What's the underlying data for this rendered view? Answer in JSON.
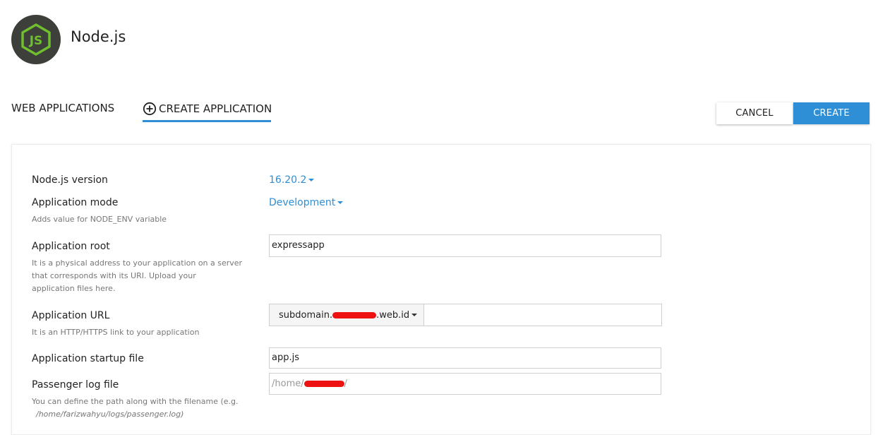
{
  "header": {
    "title": "Node.js",
    "logo_icon": "nodejs-hexagon-icon"
  },
  "tabs": [
    {
      "label": "WEB APPLICATIONS",
      "active": false
    },
    {
      "label": "CREATE APPLICATION",
      "active": true,
      "icon": "plus-circle-icon"
    }
  ],
  "actions": {
    "cancel_label": "CANCEL",
    "create_label": "CREATE"
  },
  "form": {
    "version": {
      "label": "Node.js version",
      "value": "16.20.2"
    },
    "mode": {
      "label": "Application mode",
      "value": "Development",
      "hint": "Adds value for NODE_ENV variable"
    },
    "root": {
      "label": "Application root",
      "value": "expressapp",
      "hint_line1": "It is a physical address to your application on a server",
      "hint_line2": "that corresponds with its URI. Upload your",
      "hint_line3": "application files here."
    },
    "url": {
      "label": "Application URL",
      "domain_prefix": "subdomain.",
      "domain_suffix": ".web.id",
      "hint": "It is an HTTP/HTTPS link to your application"
    },
    "startup": {
      "label": "Application startup file",
      "value": "app.js"
    },
    "log": {
      "label": "Passenger log file",
      "placeholder_prefix": "/home/",
      "placeholder_suffix": "/",
      "hint_line1": "You can define the path along with the filename (e.g.",
      "hint_line2": "/home/farizwahyu/logs/passenger.log)"
    }
  },
  "colors": {
    "accent": "#2e8fd6",
    "redaction": "#ee1111",
    "logo_bg": "#3d3f3a",
    "logo_green": "#6fbf2f"
  }
}
